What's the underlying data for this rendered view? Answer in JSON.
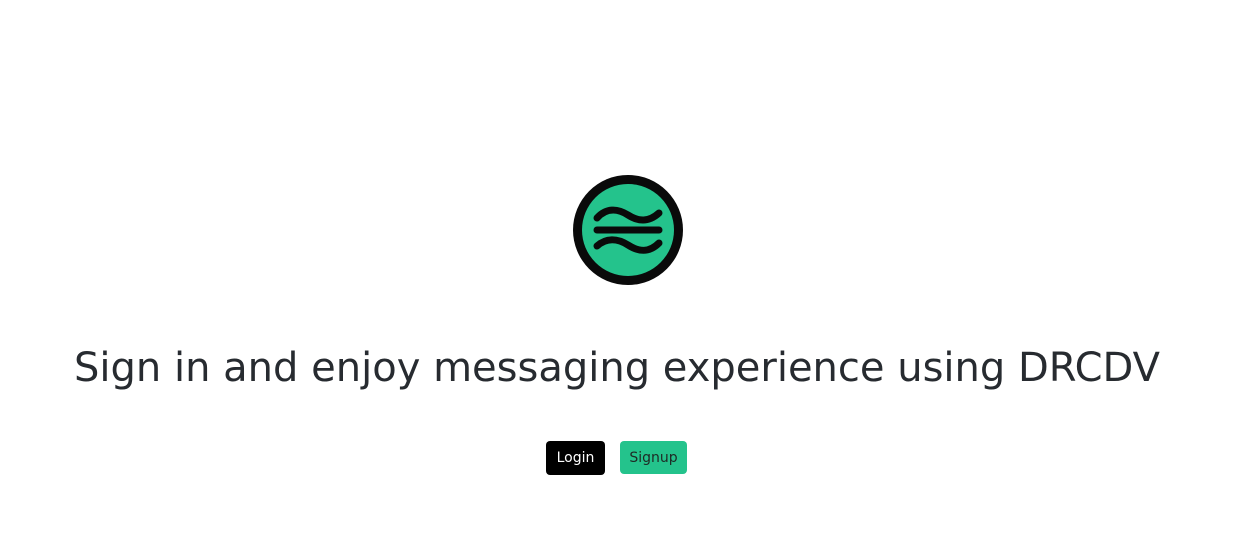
{
  "brand": {
    "logo_icon": "drcdv-wave-logo-icon",
    "colors": {
      "logo_ring": "#0a0a0a",
      "logo_fill": "#24c38c"
    }
  },
  "hero": {
    "headline": "Sign in and enjoy messaging experience using DRCDV"
  },
  "actions": {
    "login_label": "Login",
    "signup_label": "Signup",
    "colors": {
      "login_bg": "#000000",
      "signup_bg": "#24c38c"
    }
  }
}
